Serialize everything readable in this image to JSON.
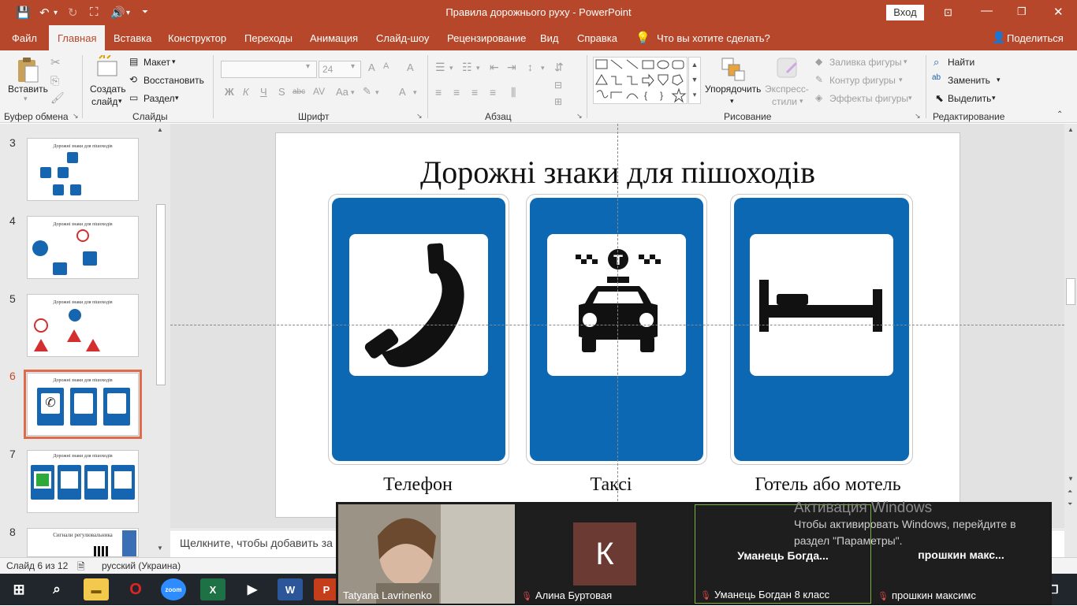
{
  "titlebar": {
    "title": "Правила дорожнього руху  -  PowerPoint",
    "signin": "Вход"
  },
  "tabs": [
    "Файл",
    "Главная",
    "Вставка",
    "Конструктор",
    "Переходы",
    "Анимация",
    "Слайд-шоу",
    "Рецензирование",
    "Вид",
    "Справка"
  ],
  "tell_me": "Что вы хотите сделать?",
  "share": "Поделиться",
  "ribbon": {
    "paste": "Вставить",
    "clipboard": "Буфер обмена",
    "new_slide_1": "Создать",
    "new_slide_2": "слайд",
    "layout": "Макет",
    "reset": "Восстановить",
    "section": "Раздел",
    "slides": "Слайды",
    "font_size": "24",
    "font": "Шрифт",
    "paragraph": "Абзац",
    "arrange": "Упорядочить",
    "quick_styles_1": "Экспресс-",
    "quick_styles_2": "стили",
    "shape_fill": "Заливка фигуры",
    "shape_outline": "Контур фигуры",
    "shape_effects": "Эффекты фигуры",
    "drawing": "Рисование",
    "find": "Найти",
    "replace": "Заменить",
    "select": "Выделить",
    "editing": "Редактирование"
  },
  "thumbnails": [
    {
      "num": "3",
      "title": "Дорожні знаки для пішоходів"
    },
    {
      "num": "4",
      "title": "Дорожні знаки для пішоходів"
    },
    {
      "num": "5",
      "title": "Дорожні знаки для пішоходів"
    },
    {
      "num": "6",
      "title": "Дорожні знаки для пішоходів"
    },
    {
      "num": "7",
      "title": "Дорожні знаки для пішоходів"
    },
    {
      "num": "8",
      "title": "Сигнали регулювальника"
    }
  ],
  "slide": {
    "title": "Дорожні знаки для пішоходів",
    "captions": [
      "Телефон",
      "Таксі",
      "Готель або мотель"
    ]
  },
  "notes_placeholder": "Щелкните, чтобы добавить за",
  "status": {
    "slide_counter": "Слайд 6 из 12",
    "language": "русский (Украина)"
  },
  "zoom": {
    "participants": [
      {
        "name": "Tatyana Lavrinenko"
      },
      {
        "name": "Алина Буртовая",
        "initial": "К"
      },
      {
        "name": "Уманець Богдан 8 класс",
        "display": "Уманець  Богда..."
      },
      {
        "name": "прошкин максимс",
        "display": "прошкин  макс..."
      }
    ]
  },
  "activation": {
    "title": "Активация Windows",
    "line1": "Чтобы активировать Windows, перейдите в",
    "line2": "раздел \"Параметры\"."
  },
  "colors": {
    "accent": "#b7472a",
    "sign_blue": "#0c68b3",
    "selection": "#e06a4c"
  }
}
